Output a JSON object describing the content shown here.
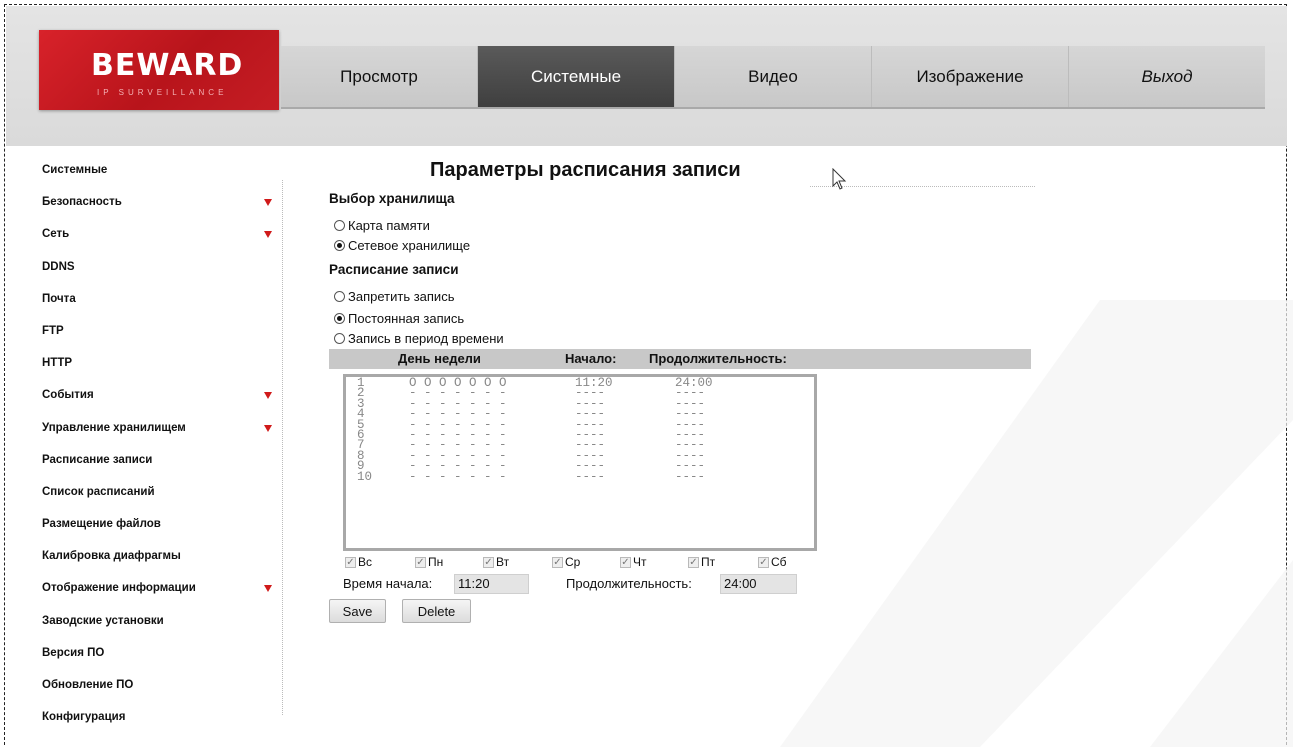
{
  "logo": {
    "brand": "BEWARD",
    "tagline": "IP SURVEILLANCE"
  },
  "nav": [
    "Просмотр",
    "Системные",
    "Видео",
    "Изображение",
    "Выход"
  ],
  "nav_active": "Системные",
  "sidebar": [
    {
      "label": "Системные",
      "expandable": false
    },
    {
      "label": "Безопасность",
      "expandable": true
    },
    {
      "label": "Сеть",
      "expandable": true
    },
    {
      "label": "DDNS",
      "expandable": false
    },
    {
      "label": "Почта",
      "expandable": false
    },
    {
      "label": "FTP",
      "expandable": false
    },
    {
      "label": "HTTP",
      "expandable": false
    },
    {
      "label": "События",
      "expandable": true
    },
    {
      "label": "Управление хранилищем",
      "expandable": true
    },
    {
      "label": "Расписание записи",
      "expandable": false
    },
    {
      "label": "Список расписаний",
      "expandable": false
    },
    {
      "label": "Размещение файлов",
      "expandable": false
    },
    {
      "label": "Калибровка диафрагмы",
      "expandable": false
    },
    {
      "label": "Отображение информации",
      "expandable": true
    },
    {
      "label": "Заводские установки",
      "expandable": false
    },
    {
      "label": "Версия ПО",
      "expandable": false
    },
    {
      "label": "Обновление ПО",
      "expandable": false
    },
    {
      "label": "Конфигурация",
      "expandable": false
    }
  ],
  "page_title": "Параметры расписания записи",
  "storage": {
    "heading": "Выбор хранилища",
    "options": [
      "Карта памяти",
      "Сетевое хранилище"
    ],
    "selected": "Сетевое хранилище"
  },
  "schedule": {
    "heading": "Расписание записи",
    "options": [
      "Запретить запись",
      "Постоянная запись",
      "Запись в период времени"
    ],
    "selected": "Постоянная запись"
  },
  "table": {
    "col_day": "День недели",
    "col_start": "Начало:",
    "col_duration": "Продолжительность:",
    "rows": [
      {
        "num": "1",
        "days": "O O O O O O O",
        "start": "11:20",
        "duration": "24:00"
      },
      {
        "num": "2",
        "days": "- - - - - - -",
        "start": "----",
        "duration": "----"
      },
      {
        "num": "3",
        "days": "- - - - - - -",
        "start": "----",
        "duration": "----"
      },
      {
        "num": "4",
        "days": "- - - - - - -",
        "start": "----",
        "duration": "----"
      },
      {
        "num": "5",
        "days": "- - - - - - -",
        "start": "----",
        "duration": "----"
      },
      {
        "num": "6",
        "days": "- - - - - - -",
        "start": "----",
        "duration": "----"
      },
      {
        "num": "7",
        "days": "- - - - - - -",
        "start": "----",
        "duration": "----"
      },
      {
        "num": "8",
        "days": "- - - - - - -",
        "start": "----",
        "duration": "----"
      },
      {
        "num": "9",
        "days": "- - - - - - -",
        "start": "----",
        "duration": "----"
      },
      {
        "num": "10",
        "days": "- - - - - - -",
        "start": "----",
        "duration": "----"
      }
    ]
  },
  "weekdays": [
    {
      "label": "Вс",
      "checked": true
    },
    {
      "label": "Пн",
      "checked": true
    },
    {
      "label": "Вт",
      "checked": true
    },
    {
      "label": "Ср",
      "checked": true
    },
    {
      "label": "Чт",
      "checked": true
    },
    {
      "label": "Пт",
      "checked": true
    },
    {
      "label": "Сб",
      "checked": true
    }
  ],
  "start_time": {
    "label": "Время начала:",
    "value": "11:20"
  },
  "duration": {
    "label": "Продолжительность:",
    "value": "24:00"
  },
  "buttons": {
    "save": "Save",
    "delete": "Delete"
  },
  "colors": {
    "brand_red": "#c41a21",
    "nav_active_bg": "#4a4a4a",
    "header_bg": "#e0e0e0"
  }
}
